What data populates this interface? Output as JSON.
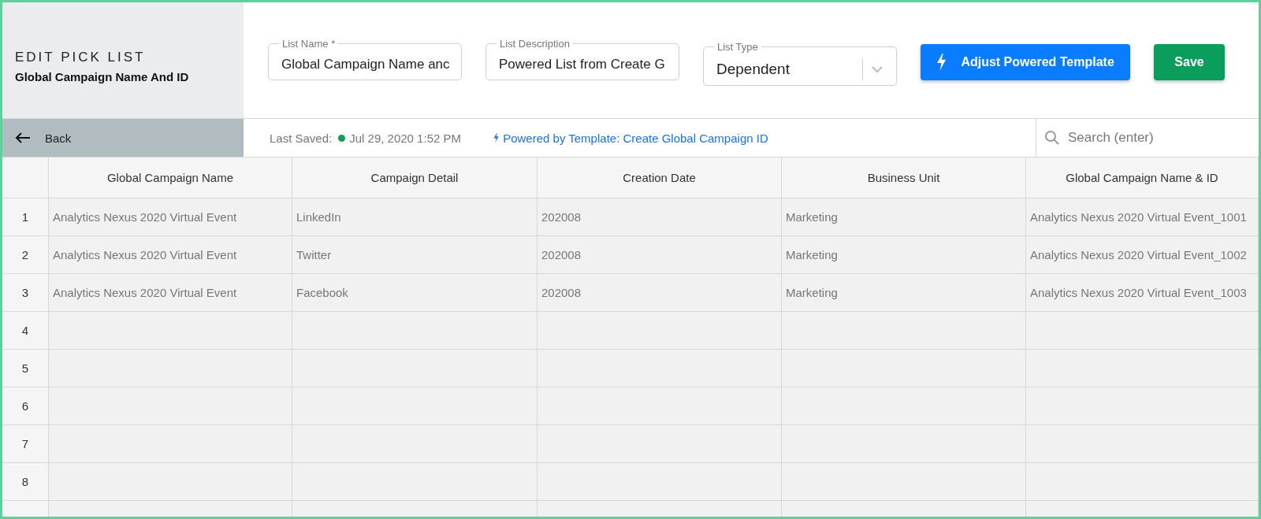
{
  "header": {
    "eyebrow": "EDIT PICK LIST",
    "title": "Global Campaign Name And ID"
  },
  "fields": [
    {
      "kind": "text",
      "label": "List Name *",
      "value": "Global Campaign Name anc"
    },
    {
      "kind": "text",
      "label": "List Description",
      "value": "Powered List from Create G"
    },
    {
      "kind": "select",
      "label": "List Type",
      "value": "Dependent"
    }
  ],
  "buttons": [
    {
      "kind": "powered",
      "label": "Adjust Powered Template"
    },
    {
      "kind": "save",
      "label": "Save"
    }
  ],
  "toolbar": {
    "back": "Back",
    "last_saved_label": "Last Saved:",
    "last_saved": "Jul 29, 2020 1:52 PM",
    "powered_link": "Powered by Template: Create Global Campaign ID",
    "search": {
      "placeholder": "Search (enter)"
    }
  },
  "table": {
    "columns": [
      "Global Campaign Name",
      "Campaign Detail",
      "Creation Date",
      "Business Unit",
      "Global Campaign Name & ID"
    ],
    "rows": [
      {
        "number": "1",
        "cells": [
          "Analytics Nexus 2020 Virtual Event",
          "LinkedIn",
          "202008",
          "Marketing",
          "Analytics Nexus 2020 Virtual Event_1001"
        ]
      },
      {
        "number": "2",
        "cells": [
          "Analytics Nexus 2020 Virtual Event",
          "Twitter",
          "202008",
          "Marketing",
          "Analytics Nexus 2020 Virtual Event_1002"
        ]
      },
      {
        "number": "3",
        "cells": [
          "Analytics Nexus 2020 Virtual Event",
          "Facebook",
          "202008",
          "Marketing",
          "Analytics Nexus 2020 Virtual Event_1003"
        ]
      },
      {
        "number": "4",
        "cells": []
      },
      {
        "number": "5",
        "cells": []
      },
      {
        "number": "6",
        "cells": []
      },
      {
        "number": "7",
        "cells": []
      },
      {
        "number": "8",
        "cells": []
      }
    ]
  }
}
